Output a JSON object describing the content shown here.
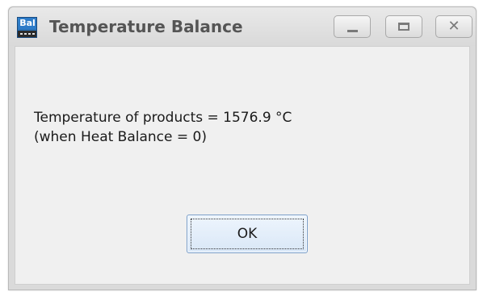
{
  "window": {
    "title": "Temperature Balance",
    "icon_text": "Bal",
    "icon": "app-icon",
    "controls": {
      "minimize_icon": "minimize-icon",
      "maximize_icon": "maximize-icon",
      "close_icon": "close-icon",
      "close_glyph": "✕"
    }
  },
  "message": {
    "line1": "Temperature of products = 1576.9 °C",
    "line2": "(when Heat Balance = 0)"
  },
  "buttons": {
    "ok_label": "OK"
  },
  "colors": {
    "title_text": "#555555",
    "client_bg": "#f0f0f0",
    "button_border": "#7a9ec9"
  }
}
